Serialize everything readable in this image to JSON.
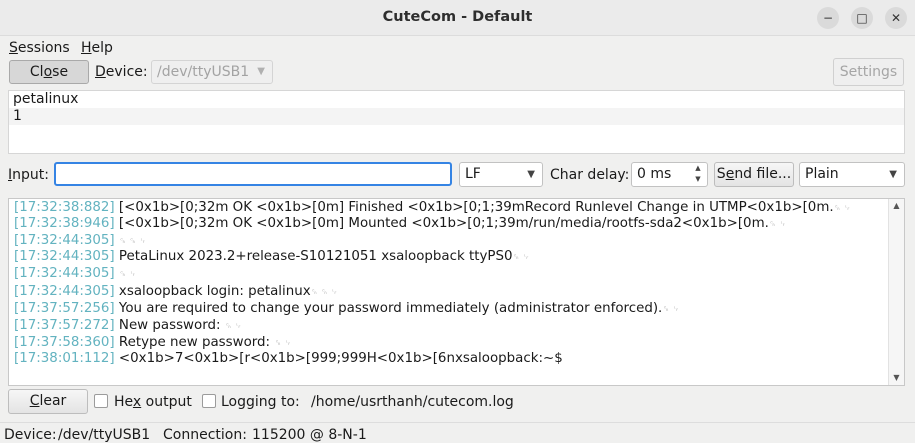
{
  "window": {
    "title": "CuteCom - Default",
    "controls": {
      "minimize": "−",
      "maximize": "□",
      "close": "✕"
    }
  },
  "menubar": {
    "sessions": {
      "first": "S",
      "rest": "essions"
    },
    "help": {
      "first": "H",
      "rest": "elp"
    }
  },
  "toolbar": {
    "close_button": {
      "first": "Cl",
      "u": "o",
      "rest": "se"
    },
    "device_label": {
      "u": "D",
      "rest": "evice:"
    },
    "device_value": "/dev/ttyUSB1",
    "settings_button": "Settings"
  },
  "output_list": [
    "petalinux",
    "1"
  ],
  "input_row": {
    "input_label": {
      "u": "I",
      "rest": "nput:"
    },
    "input_value": "",
    "line_end": "LF",
    "char_delay_label": "Char delay:",
    "char_delay_value": "0 ms",
    "send_file_button": {
      "first": "S",
      "u": "e",
      "rest": "nd file..."
    },
    "mode": "Plain"
  },
  "terminal": [
    {
      "ts": "[17:32:38:882]",
      "text": " [<0x1b>[0;32m  OK  <0x1b>[0m] Finished <0x1b>[0;1;39mRecord Runlevel Change in UTMP<0x1b>[0m.",
      "cr": "␍ ␊"
    },
    {
      "ts": "[17:32:38:946]",
      "text": " [<0x1b>[0;32m  OK  <0x1b>[0m] Mounted <0x1b>[0;1;39m/run/media/rootfs-sda2<0x1b>[0m.",
      "cr": "␍ ␊"
    },
    {
      "ts": "[17:32:44:305]",
      "text": " ",
      "cr": "␍ ␍ ␊"
    },
    {
      "ts": "[17:32:44:305]",
      "text": " PetaLinux 2023.2+release-S10121051 xsaloopback ttyPS0",
      "cr": "␍ ␊"
    },
    {
      "ts": "[17:32:44:305]",
      "text": " ",
      "cr": "␍ ␊"
    },
    {
      "ts": "[17:32:44:305]",
      "text": " xsaloopback login: petalinux",
      "cr": "␍ ␍ ␊"
    },
    {
      "ts": "[17:37:57:256]",
      "text": " You are required to change your password immediately (administrator enforced).",
      "cr": "␍ ␊"
    },
    {
      "ts": "[17:37:57:272]",
      "text": " New password: ",
      "cr": "␍ ␊"
    },
    {
      "ts": "[17:37:58:360]",
      "text": " Retype new password: ",
      "cr": "␍ ␊"
    },
    {
      "ts": "[17:38:01:112]",
      "text": " <0x1b>7<0x1b>[r<0x1b>[999;999H<0x1b>[6nxsaloopback:~$",
      "cr": ""
    }
  ],
  "bottom": {
    "clear_button": {
      "u": "C",
      "rest": "lear"
    },
    "hex_output": {
      "first": "He",
      "u": "x",
      "rest": " output",
      "checked": false
    },
    "logging": {
      "label": "Logging to:",
      "checked": false
    },
    "log_path": "/home/usrthanh/cutecom.log"
  },
  "status": {
    "device_label": "Device:",
    "device_value": "/dev/ttyUSB1",
    "connection_label": "Connection:",
    "connection_value": "115200 @ 8-N-1"
  }
}
